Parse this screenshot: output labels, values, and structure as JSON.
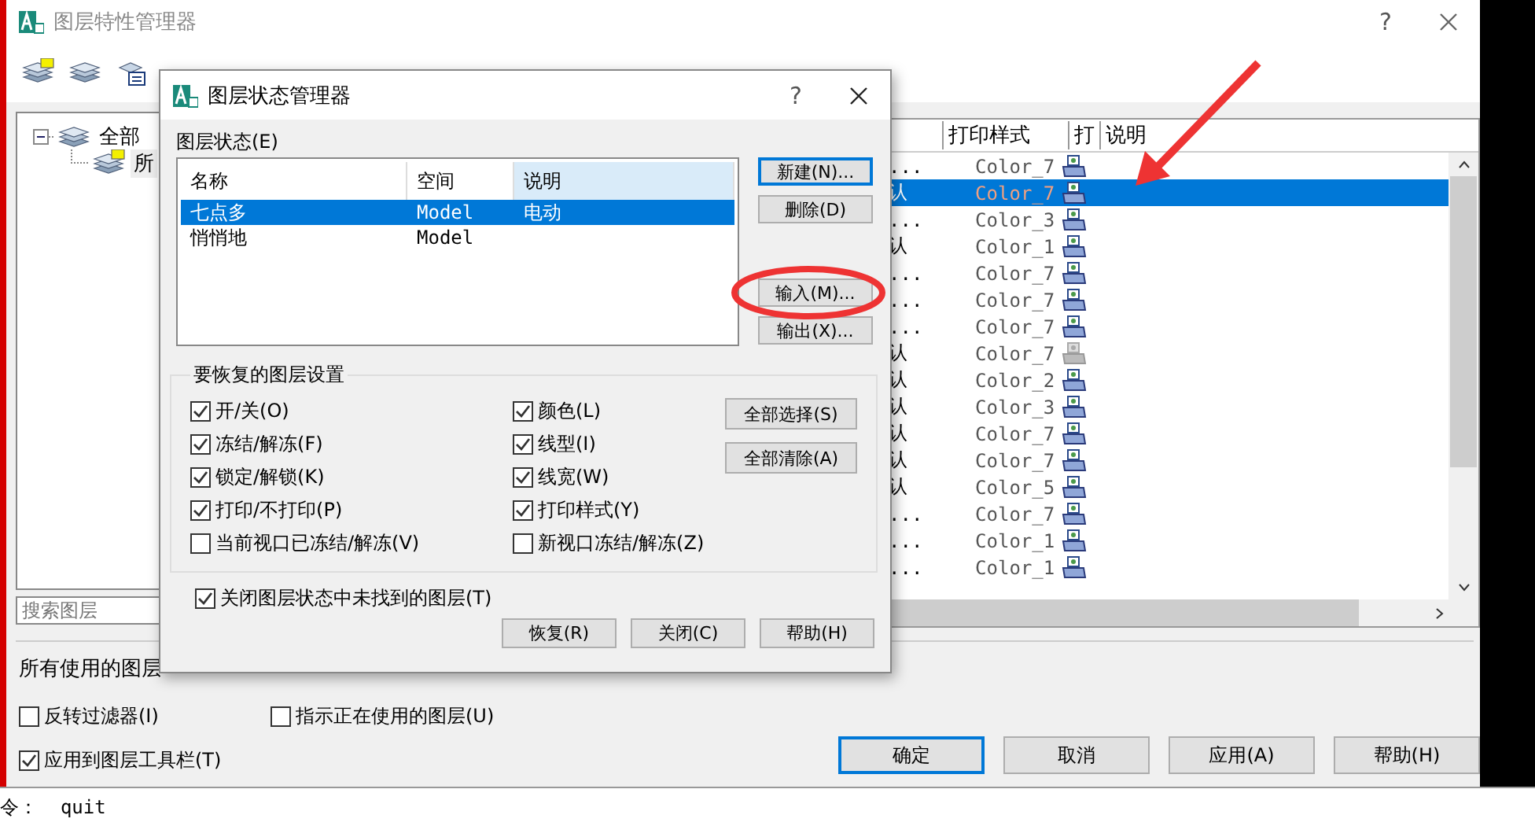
{
  "window": {
    "title": "图层特性管理器",
    "help": "?"
  },
  "tree": [
    {
      "label": "全部",
      "expanded": true,
      "children": [
        {
          "label": "所"
        }
      ]
    }
  ],
  "search": {
    "placeholder": "搜索图层"
  },
  "layer_table": {
    "columns": [
      "打印样式",
      "打",
      "说明"
    ],
    "rows": [
      {
        "column_1": "...",
        "print_style": "Color_7",
        "plot": true,
        "selected": false
      },
      {
        "column_1": "认",
        "print_style": "Color_7",
        "plot": true,
        "selected": true
      },
      {
        "column_1": "...",
        "print_style": "Color_3",
        "plot": true,
        "selected": false
      },
      {
        "column_1": "认",
        "print_style": "Color_1",
        "plot": true,
        "selected": false
      },
      {
        "column_1": "...",
        "print_style": "Color_7",
        "plot": true,
        "selected": false
      },
      {
        "column_1": "...",
        "print_style": "Color_7",
        "plot": true,
        "selected": false
      },
      {
        "column_1": "...",
        "print_style": "Color_7",
        "plot": true,
        "selected": false
      },
      {
        "column_1": "认",
        "print_style": "Color_7",
        "plot": false,
        "selected": false
      },
      {
        "column_1": "认",
        "print_style": "Color_2",
        "plot": true,
        "selected": false
      },
      {
        "column_1": "认",
        "print_style": "Color_3",
        "plot": true,
        "selected": false
      },
      {
        "column_1": "认",
        "print_style": "Color_7",
        "plot": true,
        "selected": false
      },
      {
        "column_1": "认",
        "print_style": "Color_7",
        "plot": true,
        "selected": false
      },
      {
        "column_1": "认",
        "print_style": "Color_5",
        "plot": true,
        "selected": false
      },
      {
        "column_1": "...",
        "print_style": "Color_7",
        "plot": true,
        "selected": false
      },
      {
        "column_1": "...",
        "print_style": "Color_1",
        "plot": true,
        "selected": false
      },
      {
        "column_1": "...",
        "print_style": "Color_1",
        "plot": true,
        "selected": false
      }
    ]
  },
  "status_text": "所有使用的图层",
  "options": [
    {
      "label": "反转过滤器(I)",
      "checked": false
    },
    {
      "label": "指示正在使用的图层(U)",
      "checked": false
    },
    {
      "label": "应用到图层工具栏(T)",
      "checked": true
    }
  ],
  "buttons": [
    {
      "label": "确定",
      "default": true
    },
    {
      "label": "取消",
      "default": false
    },
    {
      "label": "应用(A)",
      "default": false
    },
    {
      "label": "帮助(H)",
      "default": false
    }
  ],
  "command_line": "令：  quit",
  "dialog": {
    "title": "图层状态管理器",
    "help": "?",
    "list_label": "图层状态(E)",
    "columns": [
      {
        "label": "名称",
        "highlighted": false
      },
      {
        "label": "空间",
        "highlighted": false
      },
      {
        "label": "说明",
        "highlighted": true
      }
    ],
    "rows": [
      {
        "name": "七点多",
        "space": "Model",
        "description": "电动",
        "selected": true
      },
      {
        "name": "悄悄地",
        "space": "Model",
        "selected": false
      }
    ],
    "side_buttons": [
      {
        "label": "新建(N)...",
        "default": true
      },
      {
        "label": "删除(D)",
        "default": false
      },
      {
        "label": "输入(M)...",
        "default": false
      },
      {
        "label": "输出(X)...",
        "default": false
      }
    ],
    "group_title": "要恢复的图层设置",
    "settings": [
      {
        "label": "开/关(O)",
        "checked": true
      },
      {
        "label": "冻结/解冻(F)",
        "checked": true
      },
      {
        "label": "锁定/解锁(K)",
        "checked": true
      },
      {
        "label": "打印/不打印(P)",
        "checked": true
      },
      {
        "label": "当前视口已冻结/解冻(V)",
        "checked": false
      },
      {
        "label": "颜色(L)",
        "checked": true
      },
      {
        "label": "线型(I)",
        "checked": true
      },
      {
        "label": "线宽(W)",
        "checked": true
      },
      {
        "label": "打印样式(Y)",
        "checked": true
      },
      {
        "label": "新视口冻结/解冻(Z)",
        "checked": false
      }
    ],
    "group_buttons": [
      "全部选择(S)",
      "全部清除(A)"
    ],
    "close_missing": {
      "label": "关闭图层状态中未找到的图层(T)",
      "checked": true
    },
    "buttons": [
      "恢复(R)",
      "关闭(C)",
      "帮助(H)"
    ]
  },
  "annotations": [
    {
      "kind": "ellipse"
    },
    {
      "kind": "arrow"
    }
  ]
}
